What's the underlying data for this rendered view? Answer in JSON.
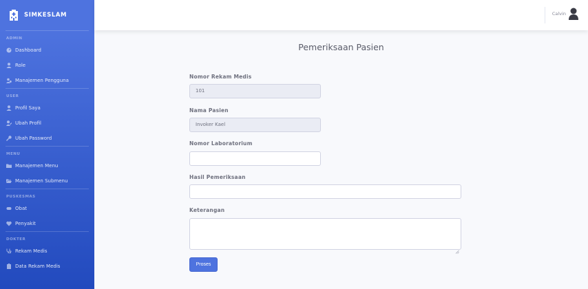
{
  "brand": {
    "name": "SIMKESLAM"
  },
  "sidebar": {
    "sections": [
      {
        "heading": "ADMIN",
        "items": [
          {
            "label": "Dashboard",
            "icon": "dashboard-icon"
          },
          {
            "label": "Role",
            "icon": "user-icon"
          },
          {
            "label": "Manajemen Pengguna",
            "icon": "users-cog-icon"
          }
        ]
      },
      {
        "heading": "USER",
        "items": [
          {
            "label": "Profil Saya",
            "icon": "user-icon"
          },
          {
            "label": "Ubah Profil",
            "icon": "user-edit-icon"
          },
          {
            "label": "Ubah Password",
            "icon": "key-icon"
          }
        ]
      },
      {
        "heading": "MENU",
        "items": [
          {
            "label": "Manajemen Menu",
            "icon": "folder-icon"
          },
          {
            "label": "Manajemen Submenu",
            "icon": "folder-open-icon"
          }
        ]
      },
      {
        "heading": "PUSKESMAS",
        "items": [
          {
            "label": "Obat",
            "icon": "capsule-icon"
          },
          {
            "label": "Penyakit",
            "icon": "heart-icon"
          }
        ]
      },
      {
        "heading": "DOKTER",
        "items": [
          {
            "label": "Rekam Medis",
            "icon": "stethoscope-icon"
          },
          {
            "label": "Data Rekam Medis",
            "icon": "clipboard-icon"
          }
        ]
      }
    ]
  },
  "topbar": {
    "user_name": "Calvin"
  },
  "main": {
    "title": "Pemeriksaan Pasien",
    "fields": {
      "nomor_rekam_medis": {
        "label": "Nomor Rekam Medis",
        "value": "101"
      },
      "nama_pasien": {
        "label": "Nama Pasien",
        "value": "Invoker Kael"
      },
      "nomor_laboratorium": {
        "label": "Nomor Laboratorium",
        "value": ""
      },
      "hasil_pemeriksaan": {
        "label": "Hasil Pemeriksaan",
        "value": ""
      },
      "keterangan": {
        "label": "Keterangan",
        "value": ""
      }
    },
    "submit_label": "Proses"
  },
  "colors": {
    "primary": "#4e73df",
    "primary_dark": "#224abe",
    "background": "#f8f9fc"
  }
}
